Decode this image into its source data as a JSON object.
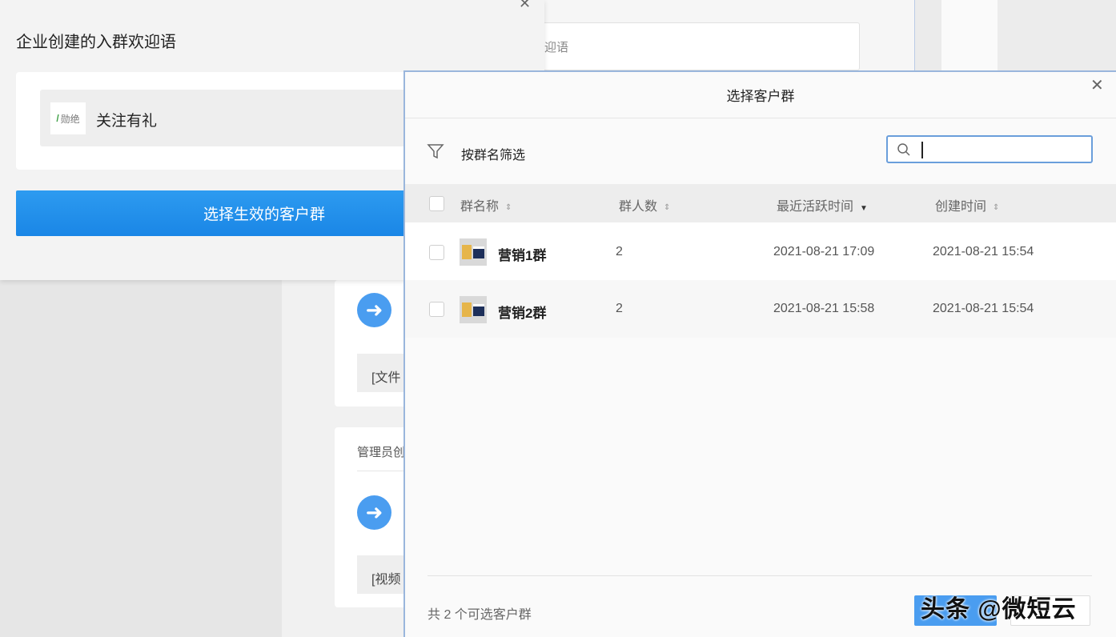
{
  "background": {
    "input_fragment": "迎语",
    "card1_text": "[文件",
    "card2_label": "管理员创",
    "card2_text": "[视频"
  },
  "welcome": {
    "title": "企业创建的入群欢迎语",
    "item_thumb_text": "勋绝",
    "item_text": "关注有礼",
    "select_button": "选择生效的客户群"
  },
  "modal": {
    "title": "选择客户群",
    "filter_label": "按群名筛选",
    "search": {
      "value": "",
      "placeholder": ""
    },
    "columns": [
      "群名称",
      "群人数",
      "最近活跃时间",
      "创建时间"
    ],
    "sort_active_icon": "sort-down-icon",
    "rows": [
      {
        "name": "营销1群",
        "count": "2",
        "last_active": "2021-08-21 17:09",
        "created": "2021-08-21 15:54"
      },
      {
        "name": "营销2群",
        "count": "2",
        "last_active": "2021-08-21 15:58",
        "created": "2021-08-21 15:54"
      }
    ],
    "footer_text": "共 2 个可选客户群"
  },
  "watermark": "头条 @微短云",
  "colors": {
    "primary": "#1a86e6",
    "modal_border": "#9ab6dc",
    "arrow": "#4a9df0"
  }
}
